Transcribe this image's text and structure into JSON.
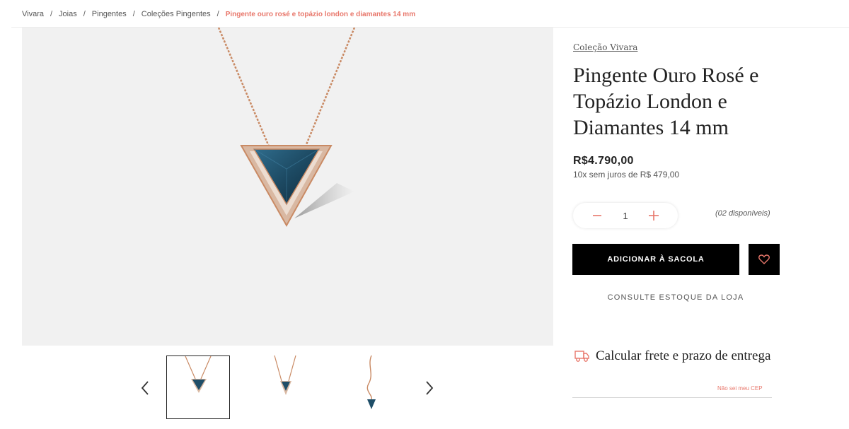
{
  "breadcrumb": {
    "items": [
      "Vivara",
      "Joias",
      "Pingentes",
      "Coleções Pingentes"
    ],
    "separator": "/",
    "current": "Pingente ouro rosé e topázio london e diamantes 14 mm"
  },
  "product": {
    "collection": "Coleção Vivara",
    "title": "Pingente Ouro Rosé e Topázio London e Diamantes 14 mm",
    "price": "R$4.790,00",
    "installments": "10x sem juros de R$ 479,00"
  },
  "quantity": {
    "value": "1",
    "minus_symbol": "−",
    "plus_symbol": "+",
    "availability": "(02 disponíveis)"
  },
  "actions": {
    "add_to_bag": "ADICIONAR À SACOLA",
    "wishlist_icon": "heart-icon",
    "check_store_stock": "CONSULTE ESTOQUE DA LOJA"
  },
  "shipping": {
    "icon": "truck-icon",
    "title": "Calcular frete e prazo de entrega",
    "no_cep_link": "Não sei meu CEP",
    "cep_value": ""
  },
  "gallery": {
    "prev_icon": "chevron-left-icon",
    "next_icon": "chevron-right-icon",
    "thumbnails": [
      {
        "view": "front",
        "active": true
      },
      {
        "view": "angle",
        "active": false
      },
      {
        "view": "side",
        "active": false
      }
    ]
  },
  "colors": {
    "accent": "#e8776b",
    "primary_button": "#000000",
    "image_background": "#f1f1f1",
    "gold_rose": "#c98a64",
    "topaz": "#1f4e68"
  }
}
